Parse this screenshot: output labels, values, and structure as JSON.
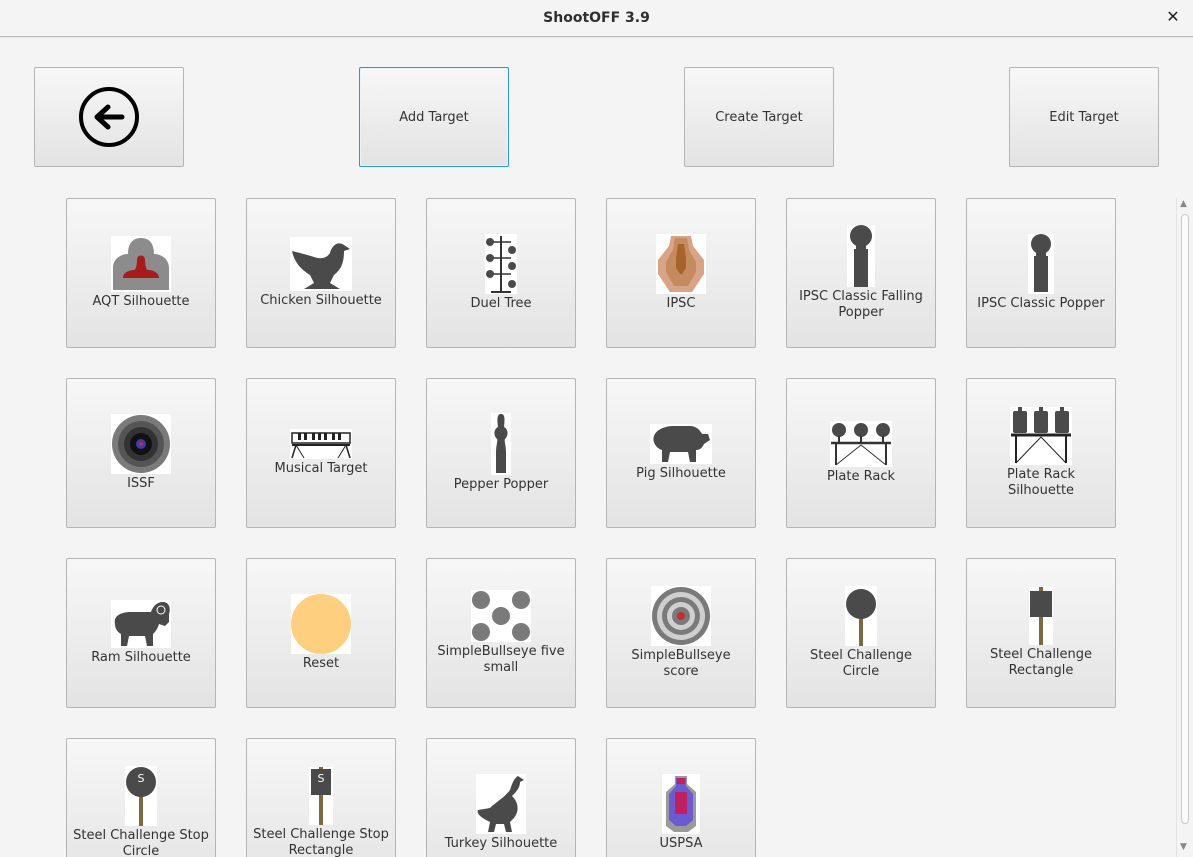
{
  "window": {
    "title": "ShootOFF 3.9",
    "close_symbol": "✕"
  },
  "toolbar": {
    "back_icon": "back-arrow-circle-icon",
    "add_target": "Add Target",
    "create_target": "Create Target",
    "edit_target": "Edit Target"
  },
  "targets": [
    {
      "label": "AQT Silhouette",
      "icon": "aqt-silhouette-icon"
    },
    {
      "label": "Chicken Silhouette",
      "icon": "chicken-silhouette-icon"
    },
    {
      "label": "Duel Tree",
      "icon": "duel-tree-icon"
    },
    {
      "label": "IPSC",
      "icon": "ipsc-icon"
    },
    {
      "label": "IPSC Classic Falling Popper",
      "icon": "ipsc-falling-popper-icon"
    },
    {
      "label": "IPSC Classic Popper",
      "icon": "ipsc-popper-icon"
    },
    {
      "label": "ISSF",
      "icon": "issf-icon"
    },
    {
      "label": "Musical Target",
      "icon": "musical-target-icon"
    },
    {
      "label": "Pepper Popper",
      "icon": "pepper-popper-icon"
    },
    {
      "label": "Pig Silhouette",
      "icon": "pig-silhouette-icon"
    },
    {
      "label": "Plate Rack",
      "icon": "plate-rack-icon"
    },
    {
      "label": "Plate Rack Silhouette",
      "icon": "plate-rack-silhouette-icon"
    },
    {
      "label": "Ram Silhouette",
      "icon": "ram-silhouette-icon"
    },
    {
      "label": "Reset",
      "icon": "reset-circle-icon"
    },
    {
      "label": "SimpleBullseye five small",
      "icon": "five-small-bullseye-icon"
    },
    {
      "label": "SimpleBullseye score",
      "icon": "bullseye-score-icon"
    },
    {
      "label": "Steel Challenge Circle",
      "icon": "steel-circle-icon"
    },
    {
      "label": "Steel Challenge Rectangle",
      "icon": "steel-rectangle-icon"
    },
    {
      "label": "Steel Challenge Stop Circle",
      "icon": "steel-stop-circle-icon",
      "stop_letter": "S"
    },
    {
      "label": "Steel Challenge Stop Rectangle",
      "icon": "steel-stop-rectangle-icon",
      "stop_letter": "S"
    },
    {
      "label": "Turkey Silhouette",
      "icon": "turkey-silhouette-icon"
    },
    {
      "label": "USPSA",
      "icon": "uspsa-icon"
    }
  ],
  "colors": {
    "focus_border": "#2d95d8",
    "silhouette": "#4a4a4a",
    "reset_fill": "#fecf7f"
  }
}
